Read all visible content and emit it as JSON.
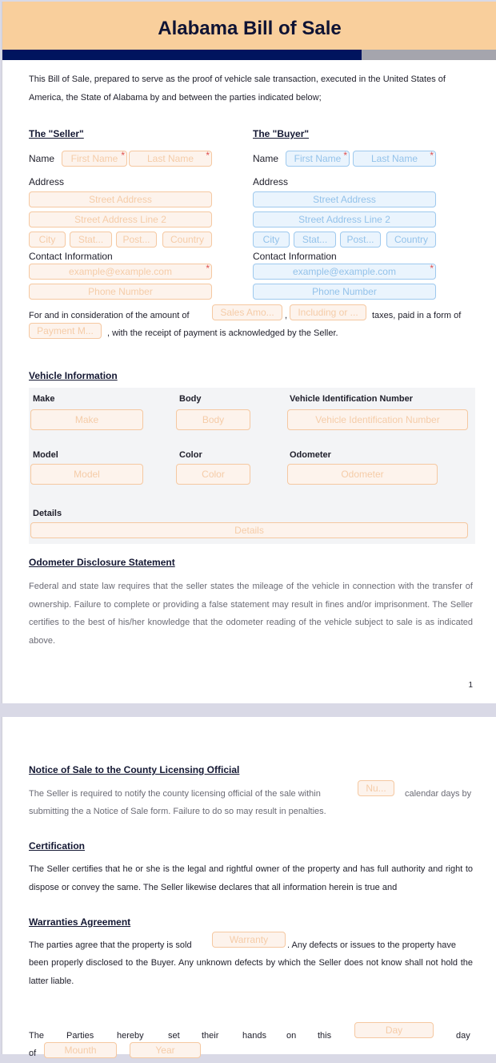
{
  "title": "Alabama Bill of Sale",
  "intro": "This Bill of Sale, prepared to serve as the proof of vehicle sale transaction, executed in the United States of America, the State of Alabama by and between the parties indicated below;",
  "seller": {
    "heading": "The \"Seller\"",
    "name_label": "Name",
    "first_name": "First Name",
    "last_name": "Last Name",
    "address_label": "Address",
    "street": "Street Address",
    "street2": "Street Address Line 2",
    "city": "City",
    "state": "Stat...",
    "postal": "Post...",
    "country": "Country",
    "contact_label": "Contact Information",
    "email": "example@example.com",
    "phone": "Phone Number"
  },
  "buyer": {
    "heading": "The \"Buyer\"",
    "name_label": "Name",
    "first_name": "First Name",
    "last_name": "Last Name",
    "address_label": "Address",
    "street": "Street Address",
    "street2": "Street Address Line 2",
    "city": "City",
    "state": "Stat...",
    "postal": "Post...",
    "country": "Country",
    "contact_label": "Contact Information",
    "email": "example@example.com",
    "phone": "Phone Number"
  },
  "required_mark": "*",
  "consideration": {
    "text1": "For and in consideration of the amount of",
    "amount_placeholder": "Sales Amo...",
    "comma": ",",
    "taxes_placeholder": "Including or ...",
    "text2": "taxes, paid in a form of",
    "payment_placeholder": "Payment M...",
    "text3": ", with the receipt of payment is acknowledged by the Seller."
  },
  "vehicle": {
    "heading": "Vehicle Information",
    "make_label": "Make",
    "make": "Make",
    "body_label": "Body",
    "body": "Body",
    "vin_label": "Vehicle Identification Number",
    "vin": "Vehicle Identification Number",
    "model_label": "Model",
    "model": "Model",
    "color_label": "Color",
    "color": "Color",
    "odometer_label": "Odometer",
    "odometer": "Odometer",
    "details_label": "Details",
    "details": "Details"
  },
  "odometer_disclosure": {
    "heading": "Odometer Disclosure Statement",
    "text": "Federal and state law requires that the seller states the mileage of the vehicle in connection with the transfer of ownership. Failure to complete or providing a false statement may result in fines and/or imprisonment. The Seller certifies to the best of his/her knowledge that the odometer reading of the vehicle subject to sale is as indicated above."
  },
  "page_number": "1",
  "notice": {
    "heading": "Notice of Sale to the County Licensing Official",
    "text1": "The Seller is required to notify the county licensing official of the sale within",
    "days_placeholder": "Nu...",
    "text2": "calendar days by",
    "text3": "submitting the a Notice of Sale form. Failure to do so may result in penalties."
  },
  "certification": {
    "heading": "Certification",
    "text": "The Seller certifies that he or she is the legal and rightful owner of the property and has full authority and right to dispose or convey the same. The Seller likewise declares that all information herein is true and"
  },
  "warranties": {
    "heading": "Warranties Agreement",
    "text1": "The parties agree that the property is sold",
    "warranty_placeholder": "Warranty",
    "text2": ". Any defects or issues to the property have",
    "text3": "been properly disclosed to the Buyer. Any unknown defects by which the Seller does not know shall not hold the latter liable."
  },
  "signing": {
    "words": [
      "The",
      "Parties",
      "hereby",
      "set",
      "their",
      "hands",
      "on",
      "this"
    ],
    "day_placeholder": "Day",
    "day_word": "day",
    "of_word": "of",
    "month_placeholder": "Mounth",
    "year_placeholder": "Year"
  }
}
